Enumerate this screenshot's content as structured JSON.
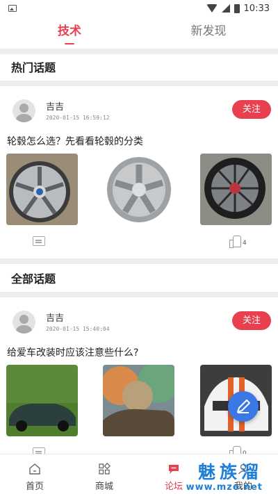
{
  "statusbar": {
    "time": "10:33"
  },
  "tabs": [
    {
      "label": "技术"
    },
    {
      "label": "新发现"
    }
  ],
  "sections": {
    "hot": "热门话题",
    "all": "全部话题"
  },
  "posts": [
    {
      "user": "吉吉",
      "time": "2020-01-15 16:59:12",
      "follow_label": "关注",
      "title": "轮毂怎么选？先看看轮毂的分类",
      "likes": "4"
    },
    {
      "user": "吉吉",
      "time": "2020-01-15 15:40:04",
      "follow_label": "关注",
      "title": "给爱车改装时应该注意些什么?",
      "likes": "0"
    }
  ],
  "bottom_nav": [
    {
      "label": "首页",
      "icon": "home-icon"
    },
    {
      "label": "商城",
      "icon": "grid-icon"
    },
    {
      "label": "论坛",
      "icon": "chat-bubble-icon"
    },
    {
      "label": "我的",
      "icon": "user-icon"
    }
  ],
  "watermark": {
    "main": "魅族溜",
    "sub": "www.mzo.net"
  },
  "colors": {
    "accent": "#e8404f",
    "fab": "#3a78e6",
    "watermark": "#1d80d6"
  }
}
